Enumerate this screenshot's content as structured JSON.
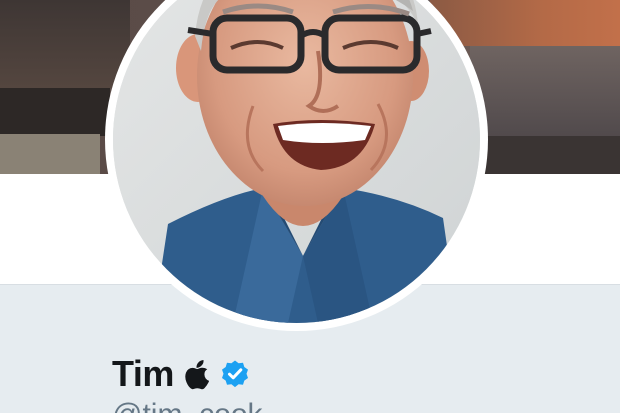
{
  "profile": {
    "name": "Tim",
    "name_icon": "apple-logo-icon",
    "verified_icon": "verified-badge-icon",
    "handle": "@tim_cook",
    "avatar": "profile-photo",
    "banner": "header-photo"
  },
  "colors": {
    "name": "#14171a",
    "handle": "#657786",
    "verified": "#1da1f2",
    "card_bg": "#e6ecf0"
  }
}
